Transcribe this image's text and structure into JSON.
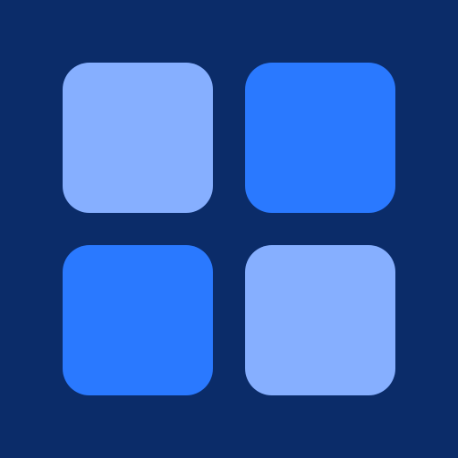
{
  "icon": {
    "name": "grid-apps-icon",
    "colors": {
      "background": "#0B2C69",
      "tile_light": "#86AFFF",
      "tile_bright": "#2A79FF"
    },
    "tiles": [
      {
        "name": "tile-top-left",
        "color": "#86AFFF"
      },
      {
        "name": "tile-top-right",
        "color": "#2A79FF"
      },
      {
        "name": "tile-bottom-left",
        "color": "#2A79FF"
      },
      {
        "name": "tile-bottom-right",
        "color": "#86AFFF"
      }
    ]
  }
}
